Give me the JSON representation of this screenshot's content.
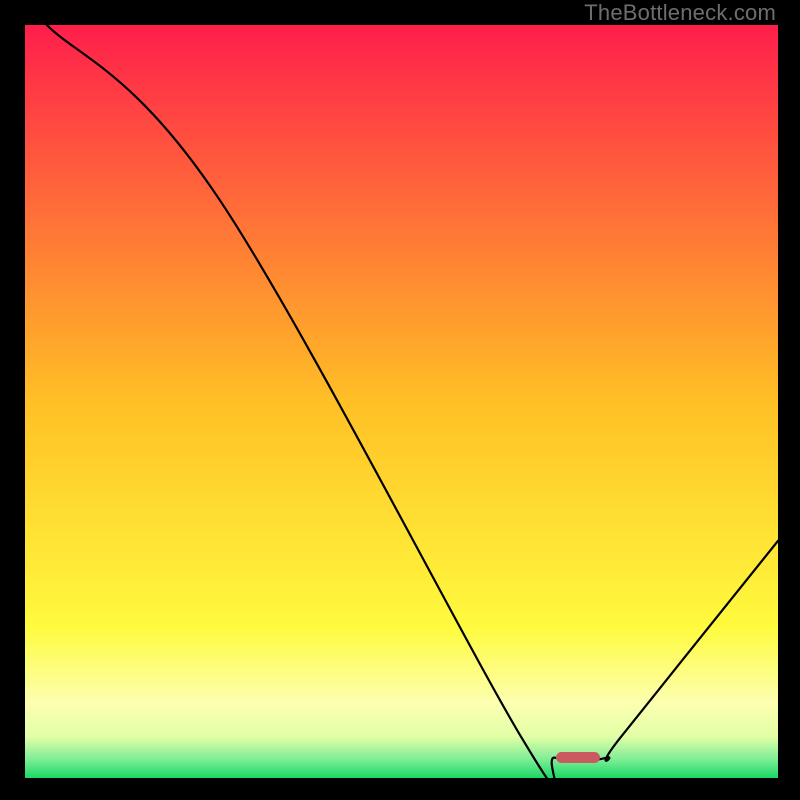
{
  "watermark": {
    "text": "TheBottleneck.com"
  },
  "chart_data": {
    "type": "line",
    "title": "",
    "xlabel": "",
    "ylabel": "",
    "xlim": [
      0,
      100
    ],
    "ylim": [
      0,
      100
    ],
    "series": [
      {
        "name": "bottleneck-curve",
        "points": [
          {
            "x": 2.9,
            "y": 100
          },
          {
            "x": 25.9,
            "y": 76.7
          },
          {
            "x": 66.1,
            "y": 5.1
          },
          {
            "x": 70.4,
            "y": 2.7
          },
          {
            "x": 77.2,
            "y": 2.7
          },
          {
            "x": 79.1,
            "y": 5.4
          },
          {
            "x": 100,
            "y": 31.5
          }
        ],
        "color": "#000000"
      }
    ],
    "marker": {
      "name": "optimal-point",
      "x": 73.5,
      "y": 2.7,
      "color": "#cb5960"
    },
    "gradient_stops": [
      {
        "pct": 0.0,
        "color": "#ff1f4b"
      },
      {
        "pct": 0.5,
        "color": "#ffc026"
      },
      {
        "pct": 0.8,
        "color": "#fffb3e"
      },
      {
        "pct": 0.9,
        "color": "#fdffb1"
      },
      {
        "pct": 0.945,
        "color": "#e2ffa7"
      },
      {
        "pct": 0.975,
        "color": "#7fee97"
      },
      {
        "pct": 1.0,
        "color": "#1bd866"
      }
    ]
  }
}
